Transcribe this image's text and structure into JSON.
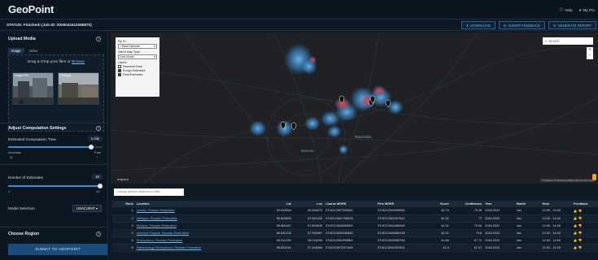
{
  "app": {
    "logo": "GeoPoint",
    "help": "Help",
    "account": "My Pro"
  },
  "status": {
    "text": "STATUS: Finished! (Job ID: 2025041511085870)"
  },
  "actions": [
    "DOWNLOAD",
    "SUBMIT FEEDBACK",
    "GENERATE REPORT"
  ],
  "upload": {
    "title": "Upload Media",
    "tabs": [
      "Image",
      "Video"
    ],
    "drop_text": "Drag & Drop your files or",
    "browse": "Browse",
    "thumbs": [
      "image1794...",
      "1782.jpg"
    ]
  },
  "settings": {
    "title": "Adjust Computation Settings",
    "time_label": "Estimated Computation Time",
    "time_value": "1 min",
    "accurate": "Accurate",
    "fast": "Fast",
    "estimates_label": "Number of Estimates",
    "estimates_value": "10",
    "estimates_min": "1",
    "estimates_max": "10",
    "model_label": "Model Selection",
    "model_value": "USACURAT",
    "time_fraction": 0.88,
    "estimates_fraction": 1.0
  },
  "region": {
    "title": "Choose Region"
  },
  "submit": "SUBMIT TO GEOPOINT",
  "map": {
    "fly_to_label": "Fly To",
    "fly_to_value": "+ Best Estimate",
    "maptype_label": "Select Map Type",
    "maptype_value": "Dark Mode",
    "layers_label": "Layers",
    "layers": [
      {
        "label": "Searched Area",
        "checked": false
      },
      {
        "label": "Rough Estimates",
        "checked": true
      },
      {
        "label": "Final Estimates",
        "checked": true
      }
    ],
    "search_placeholder": "Search",
    "city_moscow": "Moscow",
    "city_balashikha": "Balashikha",
    "mapbox": "mapbox",
    "attribution": "© Mapbox © OpenStreetMap Improve this map"
  },
  "filter_placeholder": "Choose desired features to filter",
  "table": {
    "headers": [
      "Rank",
      "Location",
      "Lat",
      "Lon",
      "Coarse MGRS",
      "Fine MGRS",
      "Score",
      "Confidence",
      "Year",
      "Month",
      "Hour",
      "Feedback"
    ],
    "rows": [
      [
        "1",
        "Lipetsk, Russian Federation",
        "52.610634",
        "39.540373",
        "37UDC2907328260",
        "37UDC2944905090",
        "42.75",
        "75.28",
        "2018-2022",
        "Jan",
        "12:00 - 14:00",
        "👍 👎"
      ],
      [
        "2",
        "Valdayev, Russian Federation",
        "55.826806",
        "37.831426",
        "37UDC2841798878",
        "37UDC2822197642",
        "42.62",
        "77",
        "2018-2022",
        "Jan",
        "12:00 - 14:00",
        "👍 👎"
      ],
      [
        "3",
        "Reutovo, Russian Federation",
        "55.806187",
        "37.805828",
        "37UDC2826085893",
        "37UDC2841088460",
        "42.51",
        "75.26",
        "2018-2022",
        "Jan",
        "12:00 - 14:00",
        "👍 👎"
      ],
      [
        "4",
        "Lesnoye Polyane, Russian Federation",
        "55.842226",
        "37.908067",
        "37UDC2852208480",
        "37UDC2849089228",
        "42.51",
        "74.6",
        "2018-2022",
        "Jan",
        "12:00 - 14:00",
        "👍 👎"
      ],
      [
        "5",
        "Shchyolkovo, Russian Federation",
        "55.912230",
        "38.018296",
        "37UDC0501999883",
        "37UDC0604058736",
        "41.86",
        "67.72",
        "2018-2022",
        "Jan",
        "12:00 - 14:00",
        "👍 👎"
      ],
      [
        "6",
        "Paleontology Shchyolkovo, Russian Federation",
        "55.820240",
        "37.446069",
        "37UDC0872207469",
        "37UDC2841397831",
        "41.8",
        "67.57",
        "2018-2022",
        "Jan",
        "12:00 - 14:00",
        "👍 👎"
      ]
    ]
  },
  "colors": {
    "accent": "#3c8ed6",
    "submit": "#1a4d7c",
    "marker": "#d03a3a",
    "heat": "#5aa6e0"
  }
}
